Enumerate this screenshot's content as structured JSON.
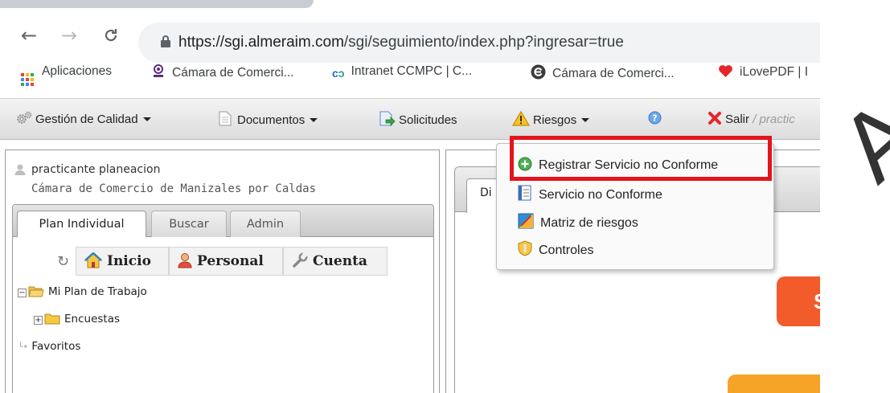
{
  "browser": {
    "url_host": "https://sgi.almeraim.com",
    "url_path": "/sgi/seguimiento/index.php?ingresar=true",
    "bookmarks": [
      {
        "label": "Aplicaciones",
        "icon": "apps-grid-icon"
      },
      {
        "label": "Cámara de Comerci...",
        "icon": "chamber-logo-icon"
      },
      {
        "label": "Intranet CCMPC | C...",
        "icon": "intranet-logo-icon"
      },
      {
        "label": "Cámara de Comerci...",
        "icon": "chamber-circle-icon"
      },
      {
        "label": "iLovePDF | I",
        "icon": "heart-icon"
      }
    ]
  },
  "menubar": {
    "gestion": "Gestión de Calidad",
    "documentos": "Documentos",
    "solicitudes": "Solicitudes",
    "riesgos": "Riesgos",
    "salir": "Salir",
    "salir_extra": "/ practic"
  },
  "user": {
    "name": "practicante planeacion",
    "org": "Cámara de Comercio de Manizales por Caldas"
  },
  "tabs": [
    "Plan Individual",
    "Buscar",
    "Admin"
  ],
  "toolbar": {
    "inicio": "Inicio",
    "personal": "Personal",
    "cuenta": "Cuenta"
  },
  "tree": {
    "root": "Mi Plan de Trabajo",
    "child": "Encuestas",
    "favoritos": "Favoritos"
  },
  "right": {
    "tab_label": "Di",
    "orange_letter": "S"
  },
  "dropdown": {
    "items": [
      "Registrar Servicio no Conforme",
      "Servicio no Conforme",
      "Matriz de riesgos",
      "Controles"
    ]
  },
  "watermark": "A",
  "colors": {
    "highlight": "#e3141c",
    "orange": "#f25b2a",
    "amber": "#f5a428"
  }
}
